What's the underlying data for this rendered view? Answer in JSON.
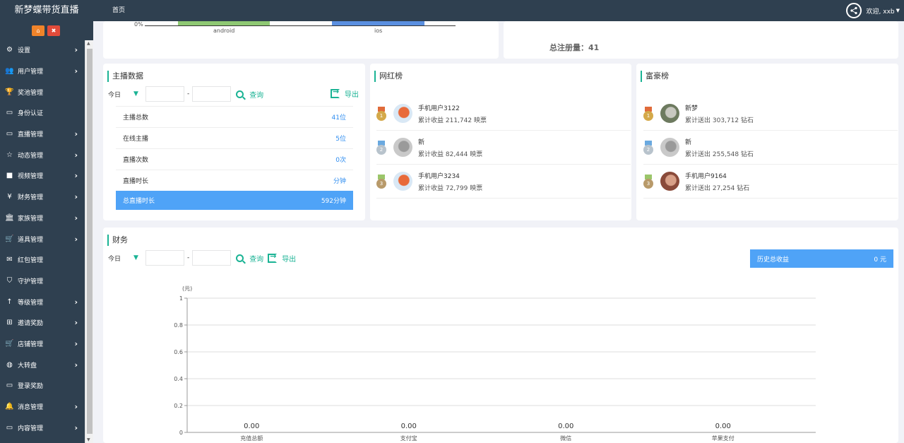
{
  "brand": "新梦蝶带货直播",
  "topnav": {
    "home": "首页"
  },
  "user": {
    "welcome": "欢迎, xxb"
  },
  "sidebar": {
    "items": [
      {
        "label": "设置",
        "icon": "gears-icon",
        "arrow": true
      },
      {
        "label": "用户管理",
        "icon": "users-icon",
        "arrow": true
      },
      {
        "label": "奖池管理",
        "icon": "trophy-icon",
        "arrow": false
      },
      {
        "label": "身份认证",
        "icon": "desktop-icon",
        "arrow": false
      },
      {
        "label": "直播管理",
        "icon": "desktop-icon",
        "arrow": true
      },
      {
        "label": "动态管理",
        "icon": "star-icon",
        "arrow": true
      },
      {
        "label": "视频管理",
        "icon": "video-icon",
        "arrow": true
      },
      {
        "label": "财务管理",
        "icon": "yen-icon",
        "arrow": true
      },
      {
        "label": "家族管理",
        "icon": "bank-icon",
        "arrow": true
      },
      {
        "label": "道具管理",
        "icon": "cart-icon",
        "arrow": true
      },
      {
        "label": "红包管理",
        "icon": "envelope-icon",
        "arrow": false
      },
      {
        "label": "守护管理",
        "icon": "shield-icon",
        "arrow": false
      },
      {
        "label": "等级管理",
        "icon": "level-up-icon",
        "arrow": true
      },
      {
        "label": "邀请奖励",
        "icon": "sitemap-icon",
        "arrow": true
      },
      {
        "label": "店铺管理",
        "icon": "cart-icon",
        "arrow": true
      },
      {
        "label": "大转盘",
        "icon": "gamepad-icon",
        "arrow": true
      },
      {
        "label": "登录奖励",
        "icon": "desktop-icon",
        "arrow": false
      },
      {
        "label": "消息管理",
        "icon": "bell-icon",
        "arrow": true
      },
      {
        "label": "内容管理",
        "icon": "desktop-icon",
        "arrow": true
      }
    ]
  },
  "platform_chart": {
    "tick_0": "0%",
    "categories": [
      "android",
      "ios"
    ]
  },
  "register_total": "总注册量：41",
  "anchor_panel": {
    "title": "主播数据",
    "range": "今日",
    "dash": "-",
    "search": "查询",
    "export": "导出",
    "rows": [
      {
        "label": "主播总数",
        "value": "41位"
      },
      {
        "label": "在线主播",
        "value": "5位"
      },
      {
        "label": "直播次数",
        "value": "0次"
      },
      {
        "label": "直播时长",
        "value": "分钟"
      },
      {
        "label": "总直播时长",
        "value": "592分钟"
      }
    ]
  },
  "influencer_panel": {
    "title": "网红榜",
    "items": [
      {
        "name": "手机用户3122",
        "sub": "累计收益 211,742 映票",
        "medal": "gold"
      },
      {
        "name": "新",
        "sub": "累计收益 82,444 映票",
        "medal": "silver"
      },
      {
        "name": "手机用户3234",
        "sub": "累计收益 72,799 映票",
        "medal": "bronze"
      }
    ]
  },
  "rich_panel": {
    "title": "富豪榜",
    "items": [
      {
        "name": "新梦",
        "sub": "累计送出 303,712 钻石",
        "medal": "gold"
      },
      {
        "name": "新",
        "sub": "累计送出 255,548 钻石",
        "medal": "silver"
      },
      {
        "name": "手机用户9164",
        "sub": "累计送出 27,254 钻石",
        "medal": "bronze"
      }
    ]
  },
  "finance_panel": {
    "title": "财务",
    "range": "今日",
    "dash": "-",
    "search": "查询",
    "export": "导出",
    "total_label": "历史总收益",
    "total_value": "0 元"
  },
  "chart_data": {
    "type": "bar",
    "ylabel": "(元)",
    "ylim": [
      0,
      1
    ],
    "yticks": [
      "1",
      "0.8",
      "0.6",
      "0.4",
      "0.2",
      "0"
    ],
    "categories": [
      "充值总额",
      "支付宝",
      "微信",
      "苹果支付"
    ],
    "values": [
      0,
      0,
      0,
      0
    ],
    "value_labels": [
      "0.00",
      "0.00",
      "0.00",
      "0.00"
    ]
  }
}
